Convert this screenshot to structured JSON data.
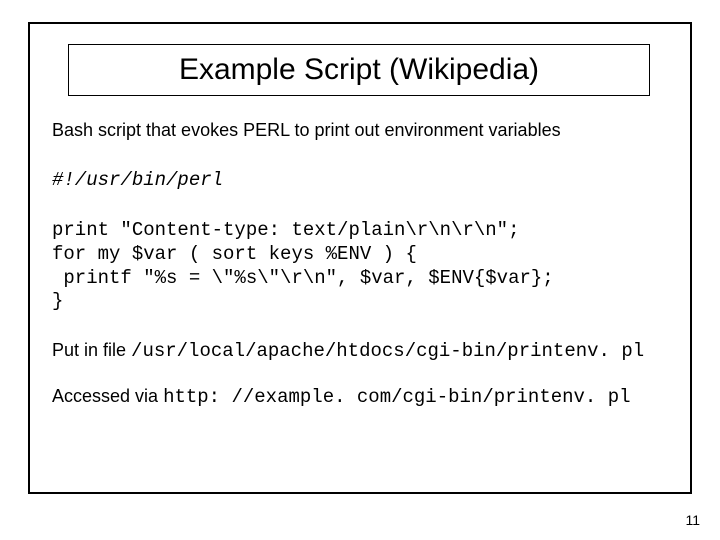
{
  "title": "Example Script (Wikipedia)",
  "intro": "Bash script that evokes PERL to print out environment variables",
  "shebang": "#!/usr/bin/perl",
  "code": "print \"Content-type: text/plain\\r\\n\\r\\n\";\nfor my $var ( sort keys %ENV ) {\n printf \"%s = \\\"%s\\\"\\r\\n\", $var, $ENV{$var};\n}",
  "putin_prefix": "Put in file ",
  "putin_path": "/usr/local/apache/htdocs/cgi-bin/printenv. pl",
  "accessed_prefix": "Accessed via ",
  "accessed_url": "http: //example. com/cgi-bin/printenv. pl",
  "page_number": "11"
}
